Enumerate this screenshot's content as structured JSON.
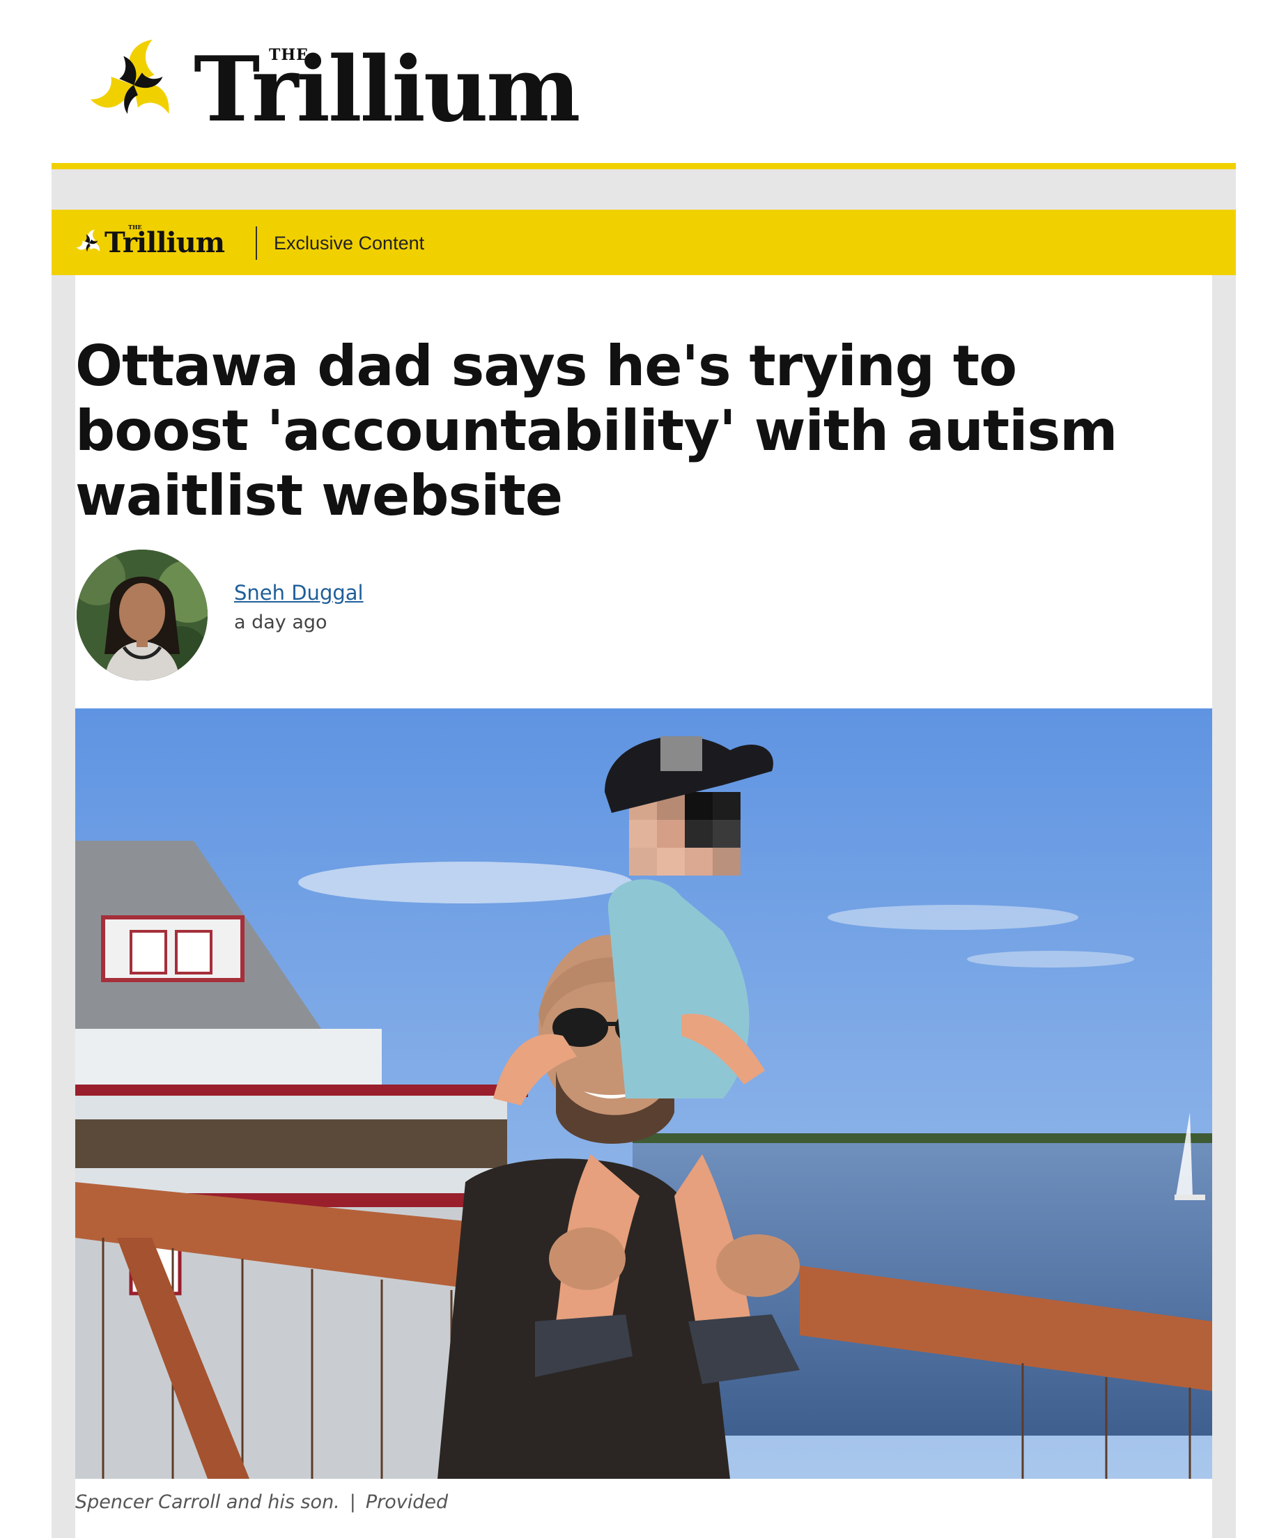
{
  "masthead": {
    "the": "THE",
    "wordmark": "Trillium"
  },
  "article_bar": {
    "the": "THE",
    "wordmark": "Trillium",
    "section_label": "Exclusive Content"
  },
  "article": {
    "headline": "Ottawa dad says he's trying to boost 'accountability' with autism waitlist website",
    "author": "Sneh Duggal",
    "published": "a day ago",
    "caption_text": "Spencer Carroll and his son.",
    "caption_separator": "|",
    "caption_credit": "Provided"
  },
  "colors": {
    "brand_yellow": "#f1d000",
    "link_blue": "#1f5e99",
    "page_gray": "#e6e6e6"
  },
  "icons": {
    "brand_logo": "trillium-pinwheel-icon"
  }
}
